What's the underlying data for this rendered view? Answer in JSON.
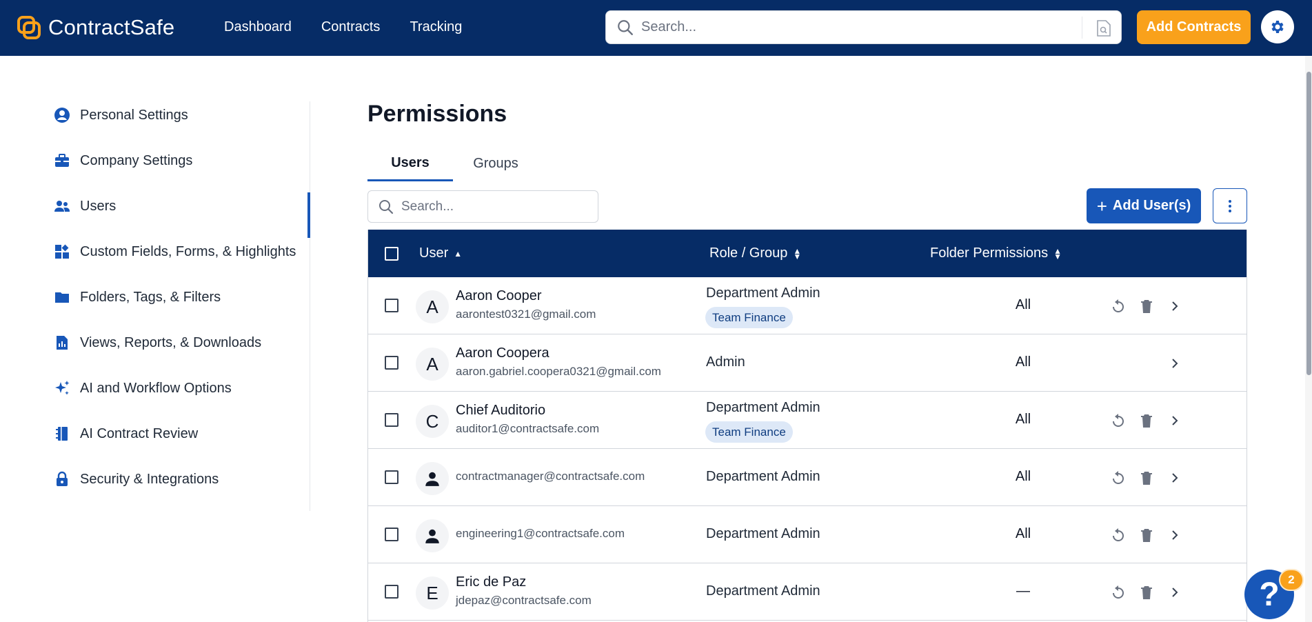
{
  "app": {
    "name": "ContractSafe",
    "colors": {
      "navy": "#062c66",
      "accent_orange": "#f9a11b",
      "primary_blue": "#1857b8"
    }
  },
  "header": {
    "nav": [
      "Dashboard",
      "Contracts",
      "Tracking"
    ],
    "search_placeholder": "Search...",
    "add_contracts_label": "Add Contracts",
    "icons": [
      "search-icon",
      "document-search-icon",
      "gear-icon"
    ]
  },
  "sidebar": {
    "items": [
      {
        "label": "Personal Settings",
        "icon": "user-circle-icon"
      },
      {
        "label": "Company Settings",
        "icon": "briefcase-icon"
      },
      {
        "label": "Users",
        "icon": "users-icon",
        "active": true
      },
      {
        "label": "Custom Fields, Forms, & Highlights",
        "icon": "widgets-icon"
      },
      {
        "label": "Folders, Tags, & Filters",
        "icon": "folder-icon"
      },
      {
        "label": "Views, Reports, & Downloads",
        "icon": "report-icon"
      },
      {
        "label": "AI and Workflow Options",
        "icon": "sparkle-icon"
      },
      {
        "label": "AI Contract Review",
        "icon": "notebook-icon"
      },
      {
        "label": "Security & Integrations",
        "icon": "lock-icon"
      }
    ]
  },
  "main": {
    "title": "Permissions",
    "tabs": [
      {
        "label": "Users",
        "active": true
      },
      {
        "label": "Groups",
        "active": false
      }
    ],
    "search_placeholder": "Search...",
    "add_users_label": "Add User(s)",
    "table": {
      "columns": [
        "User",
        "Role / Group",
        "Folder Permissions"
      ],
      "rows": [
        {
          "initial": "A",
          "name": "Aaron Cooper",
          "email": "aarontest0321@gmail.com",
          "role": "Department Admin",
          "group": "Team Finance",
          "folders": "All",
          "actions": [
            "reset-icon",
            "trash-icon",
            "chevron-right-icon"
          ]
        },
        {
          "initial": "A",
          "name": "Aaron Coopera",
          "email": "aaron.gabriel.coopera0321@gmail.com",
          "role": "Admin",
          "group": "",
          "folders": "All",
          "actions": [
            "chevron-right-icon"
          ]
        },
        {
          "initial": "C",
          "name": "Chief Auditorio",
          "email": "auditor1@contractsafe.com",
          "role": "Department Admin",
          "group": "Team Finance",
          "folders": "All",
          "actions": [
            "reset-icon",
            "trash-icon",
            "chevron-right-icon"
          ]
        },
        {
          "initial": "",
          "name": "",
          "email": "contractmanager@contractsafe.com",
          "role": "Department Admin",
          "group": "",
          "folders": "All",
          "actions": [
            "reset-icon",
            "trash-icon",
            "chevron-right-icon"
          ]
        },
        {
          "initial": "",
          "name": "",
          "email": "engineering1@contractsafe.com",
          "role": "Department Admin",
          "group": "",
          "folders": "All",
          "actions": [
            "reset-icon",
            "trash-icon",
            "chevron-right-icon"
          ]
        },
        {
          "initial": "E",
          "name": "Eric de Paz",
          "email": "jdepaz@contractsafe.com",
          "role": "Department Admin",
          "group": "",
          "folders": "—",
          "actions": [
            "reset-icon",
            "trash-icon",
            "chevron-right-icon"
          ]
        }
      ]
    }
  },
  "help": {
    "label": "?",
    "badge_count": "2"
  }
}
